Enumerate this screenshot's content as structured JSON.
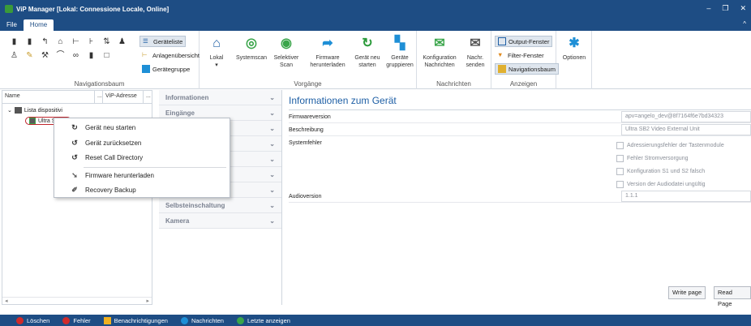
{
  "window": {
    "title": "ViP Manager [Lokal: Connessione Locale, Online]"
  },
  "menu": {
    "file": "File",
    "home": "Home"
  },
  "ribbon": {
    "nav": {
      "label": "Navigationsbaum",
      "list": "Geräteliste",
      "overview": "Anlagenübersicht",
      "group": "Gerätegruppe"
    },
    "vorgaenge": {
      "label": "Vorgänge",
      "lokal": "Lokal",
      "systemscan": "Systemscan",
      "selektiver": "Selektiver",
      "scan": "Scan",
      "fw1": "Firmware",
      "fw2": "herunterladen",
      "gn1": "Gerät neu",
      "gn2": "starten",
      "gg1": "Geräte",
      "gg2": "gruppieren"
    },
    "nachrichten": {
      "label": "Nachrichten",
      "konf1": "Konfiguration",
      "konf2": "Nachrichten",
      "send1": "Nachr.",
      "send2": "senden"
    },
    "anzeigen": {
      "label": "Anzeigen",
      "output": "Output-Fenster",
      "filter": "Filter-Fenster",
      "navbaum": "Navigationsbaum"
    },
    "optionen": "Optionen"
  },
  "tree": {
    "col_name": "Name",
    "col_dots": "...",
    "col_vip": "ViP-Adresse",
    "col_dots2": "...",
    "root": "Lista dispositivi",
    "device": "Ultra SB2"
  },
  "accordion": [
    "Informationen",
    "Eingänge",
    "",
    "",
    "",
    "",
    "",
    "Selbsteinschaltung",
    "Kamera"
  ],
  "info": {
    "heading": "Informationen zum Gerät",
    "firmware_label": "Firmwareversion",
    "firmware_value": "apv=angelo_dev@8f7164f6e7bd34323",
    "desc_label": "Beschreibung",
    "desc_value": "Ultra SB2 Video External Unit",
    "sys_label": "Systemfehler",
    "errors": [
      "Adressierungsfehler der Tastenmodule",
      "Fehler Stromversorgung",
      "Konfiguration S1 und S2 falsch",
      "Version der Audiodatei ungültig"
    ],
    "audio_label": "Audioversion",
    "audio_value": "1.1.1",
    "write": "Write page",
    "read": "Read Page"
  },
  "context_menu": [
    "Gerät neu starten",
    "Gerät zurücksetzen",
    "Reset Call Directory",
    "Firmware herunterladen",
    "Recovery Backup"
  ],
  "status": [
    "Löschen",
    "Fehler",
    "Benachrichtigungen",
    "Nachrichten",
    "Letzte anzeigen"
  ]
}
